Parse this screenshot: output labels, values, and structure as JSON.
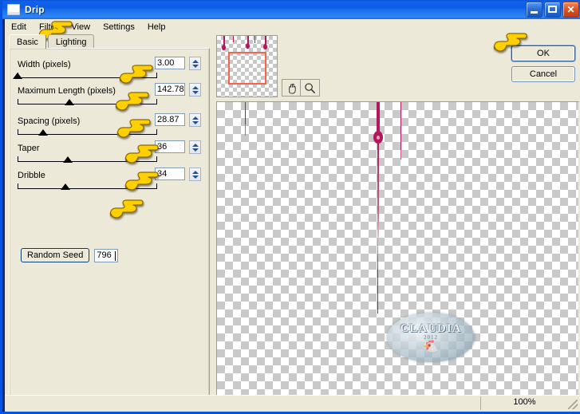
{
  "window": {
    "title": "Drip",
    "icon": "window-icon",
    "minimize_label": "Minimize",
    "maximize_label": "Maximize",
    "close_label": "Close"
  },
  "menubar": {
    "items": [
      {
        "label": "Edit"
      },
      {
        "label": "Filter"
      },
      {
        "label": "View"
      },
      {
        "label": "Settings"
      },
      {
        "label": "Help"
      }
    ]
  },
  "tabs": [
    {
      "label": "Basic",
      "active": true
    },
    {
      "label": "Lighting",
      "active": false
    }
  ],
  "controls": [
    {
      "label": "Width (pixels)",
      "value": "3.00",
      "thumb_pct": 0
    },
    {
      "label": "Maximum Length (pixels)",
      "value": "142.78",
      "thumb_pct": 37
    },
    {
      "label": "Spacing (pixels)",
      "value": "28.87",
      "thumb_pct": 18
    },
    {
      "label": "Taper",
      "value": "36",
      "thumb_pct": 36
    },
    {
      "label": "Dribble",
      "value": "34",
      "thumb_pct": 34
    }
  ],
  "random_seed": {
    "button_label": "Random Seed",
    "value": "796"
  },
  "buttons": {
    "ok": "OK",
    "cancel": "Cancel"
  },
  "tools": [
    {
      "name": "pan-tool",
      "glyph": "✋"
    },
    {
      "name": "zoom-tool",
      "glyph": "⌕"
    }
  ],
  "statusbar": {
    "zoom": "100%"
  },
  "watermark": {
    "text": "CLAUDIA",
    "year": "2012"
  },
  "colors": {
    "drip": "#b5175c",
    "drip_light": "#c4607f",
    "viewport_rect": "#f4644f",
    "titlebar": "#0a52d6",
    "panel": "#ece9d8"
  }
}
